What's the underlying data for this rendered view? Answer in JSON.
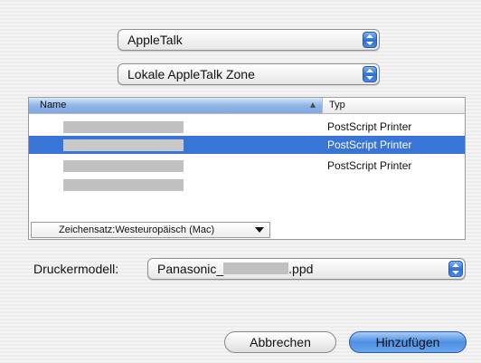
{
  "network": {
    "selected": "AppleTalk"
  },
  "zone": {
    "selected": "Lokale AppleTalk Zone"
  },
  "printer_list": {
    "columns": [
      "Name",
      "Typ"
    ],
    "rows": [
      {
        "name": "",
        "type": "PostScript Printer",
        "selected": false
      },
      {
        "name": "",
        "type": "PostScript Printer",
        "selected": true
      },
      {
        "name": "",
        "type": "PostScript Printer",
        "selected": false
      },
      {
        "name": "",
        "type": "",
        "selected": false
      }
    ]
  },
  "charset": {
    "label": "Zeichensatz:Westeuropäisch (Mac)"
  },
  "printer_model": {
    "label": "Druckermodell:",
    "value_prefix": "Panasonic_",
    "value_suffix": ".ppd"
  },
  "buttons": {
    "cancel": "Abbrechen",
    "add": "Hinzufügen"
  },
  "colors": {
    "selection": "#3875d7",
    "accent": "#4d8fe3"
  },
  "icons": {
    "stepper": "up-down-arrows-icon",
    "sort": "sort-ascending-icon",
    "charset_arrow": "chevron-down-icon"
  }
}
